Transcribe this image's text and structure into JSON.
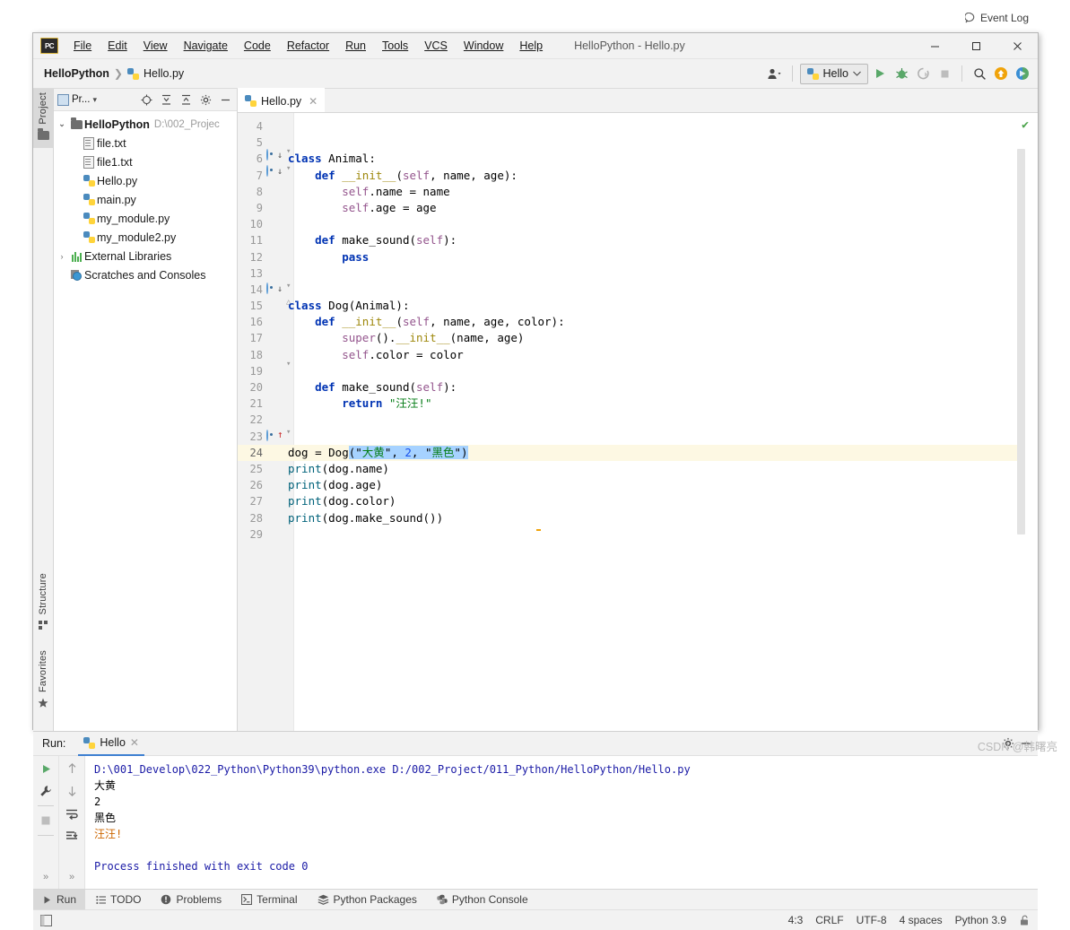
{
  "window": {
    "title": "HelloPython - Hello.py",
    "logo_text": "PC",
    "minimize": "—",
    "maximize": "☐",
    "close": "✕"
  },
  "menu": [
    {
      "label": "File"
    },
    {
      "label": "Edit"
    },
    {
      "label": "View"
    },
    {
      "label": "Navigate"
    },
    {
      "label": "Code"
    },
    {
      "label": "Refactor"
    },
    {
      "label": "Run"
    },
    {
      "label": "Tools"
    },
    {
      "label": "VCS"
    },
    {
      "label": "Window"
    },
    {
      "label": "Help"
    }
  ],
  "breadcrumb": {
    "project": "HelloPython",
    "separator": "❯",
    "file": "Hello.py"
  },
  "toolbar": {
    "run_config": "Hello",
    "chevron": "⌄",
    "user_icon": "user-icon",
    "run_icon": "run-icon",
    "debug_icon": "debug-icon",
    "coverage_icon": "run-with-coverage-icon",
    "stop_icon": "stop-icon",
    "search_icon": "search-everywhere-icon",
    "update_icon": "update-project-icon",
    "profile_icon": "profile-icon"
  },
  "left_strip": [
    {
      "label": "Project",
      "icon": "folder-icon",
      "active": true
    },
    {
      "label": "Structure",
      "icon": "structure-icon",
      "active": false
    },
    {
      "label": "Favorites",
      "icon": "star-icon",
      "active": false
    }
  ],
  "project_panel": {
    "title": "Pr...",
    "title_chevron": "▾",
    "icons": [
      "locate-icon",
      "expand-all-icon",
      "collapse-all-icon",
      "settings-icon",
      "hide-icon"
    ],
    "tree": [
      {
        "label": "HelloPython",
        "path": "D:\\002_Projec",
        "icon": "folder-icon",
        "arrow": "⌄",
        "indent": 0,
        "bold": true
      },
      {
        "label": "file.txt",
        "path": "",
        "icon": "text-file-icon",
        "arrow": "",
        "indent": 1,
        "bold": false
      },
      {
        "label": "file1.txt",
        "path": "",
        "icon": "text-file-icon",
        "arrow": "",
        "indent": 1,
        "bold": false
      },
      {
        "label": "Hello.py",
        "path": "",
        "icon": "python-file-icon",
        "arrow": "",
        "indent": 1,
        "bold": false
      },
      {
        "label": "main.py",
        "path": "",
        "icon": "python-file-icon",
        "arrow": "",
        "indent": 1,
        "bold": false
      },
      {
        "label": "my_module.py",
        "path": "",
        "icon": "python-file-icon",
        "arrow": "",
        "indent": 1,
        "bold": false
      },
      {
        "label": "my_module2.py",
        "path": "",
        "icon": "python-file-icon",
        "arrow": "",
        "indent": 1,
        "bold": false
      },
      {
        "label": "External Libraries",
        "path": "",
        "icon": "libraries-icon",
        "arrow": "›",
        "indent": 0,
        "bold": false
      },
      {
        "label": "Scratches and Consoles",
        "path": "",
        "icon": "scratches-icon",
        "arrow": "",
        "indent": 0,
        "bold": false
      }
    ]
  },
  "editor": {
    "tab": {
      "label": "Hello.py",
      "icon": "python-file-icon",
      "close": "✕"
    },
    "inspection_ok": "✔",
    "first_line": 4,
    "lines": [
      {
        "n": 4,
        "text": ""
      },
      {
        "n": 5,
        "text": ""
      },
      {
        "n": 6,
        "text": "class Animal:"
      },
      {
        "n": 7,
        "text": "    def __init__(self, name, age):"
      },
      {
        "n": 8,
        "text": "        self.name = name"
      },
      {
        "n": 9,
        "text": "        self.age = age"
      },
      {
        "n": 10,
        "text": ""
      },
      {
        "n": 11,
        "text": "    def make_sound(self):"
      },
      {
        "n": 12,
        "text": "        pass"
      },
      {
        "n": 13,
        "text": ""
      },
      {
        "n": 14,
        "text": ""
      },
      {
        "n": 15,
        "text": "class Dog(Animal):"
      },
      {
        "n": 16,
        "text": "    def __init__(self, name, age, color):"
      },
      {
        "n": 17,
        "text": "        super().__init__(name, age)"
      },
      {
        "n": 18,
        "text": "        self.color = color"
      },
      {
        "n": 19,
        "text": ""
      },
      {
        "n": 20,
        "text": "    def make_sound(self):"
      },
      {
        "n": 21,
        "text": "        return \"汪汪!\""
      },
      {
        "n": 22,
        "text": ""
      },
      {
        "n": 23,
        "text": ""
      },
      {
        "n": 24,
        "text": "dog = Dog(\"大黄\", 2, \"黑色\")"
      },
      {
        "n": 25,
        "text": "print(dog.name)"
      },
      {
        "n": 26,
        "text": "print(dog.age)"
      },
      {
        "n": 27,
        "text": "print(dog.color)"
      },
      {
        "n": 28,
        "text": "print(dog.make_sound())"
      },
      {
        "n": 29,
        "text": ""
      }
    ],
    "highlighted_line": 24,
    "selection_text": "(\"大黄\", 2, \"黑色\")",
    "breakpoint_lines": [
      6,
      7,
      11,
      20
    ],
    "bulb_line": 23
  },
  "run_panel": {
    "label": "Run:",
    "tab": "Hello",
    "tab_close": "✕",
    "settings_icon": "gear-icon",
    "hide_icon": "minimize-icon",
    "tools_left": [
      "rerun-icon",
      "settings-wrench-icon",
      "stop-icon",
      "expand-more-icon"
    ],
    "tools_right": [
      "up-icon",
      "down-icon",
      "soft-wrap-icon",
      "scroll-to-end-icon",
      "expand-more-icon"
    ],
    "console": [
      {
        "text": "D:\\001_Develop\\022_Python\\Python39\\python.exe D:/002_Project/011_Python/HelloPython/Hello.py",
        "style": "path"
      },
      {
        "text": "大黄",
        "style": "plain"
      },
      {
        "text": "2",
        "style": "plain"
      },
      {
        "text": "黑色",
        "style": "plain"
      },
      {
        "text": "汪汪!",
        "style": "bang"
      },
      {
        "text": "",
        "style": "plain"
      },
      {
        "text": "Process finished with exit code 0",
        "style": "done"
      }
    ]
  },
  "bottom_tabs": [
    {
      "label": "Run",
      "icon": "run-icon",
      "active": true
    },
    {
      "label": "TODO",
      "icon": "todo-icon",
      "active": false
    },
    {
      "label": "Problems",
      "icon": "problems-icon",
      "active": false
    },
    {
      "label": "Terminal",
      "icon": "terminal-icon",
      "active": false
    },
    {
      "label": "Python Packages",
      "icon": "packages-icon",
      "active": false
    },
    {
      "label": "Python Console",
      "icon": "python-console-icon",
      "active": false
    }
  ],
  "event_log": {
    "label": "Event Log",
    "icon": "balloon-icon"
  },
  "status_bar": {
    "caret": "4:3",
    "line_separator": "CRLF",
    "encoding": "UTF-8",
    "indent": "4 spaces",
    "interpreter": "Python 3.9",
    "lock_icon": "unlocked-icon"
  },
  "watermark": "CSDN @韩曙亮",
  "colors": {
    "accent": "#3d7fd1",
    "keyword": "#0033b3",
    "string": "#067d17",
    "number": "#1750eb",
    "self": "#94558d",
    "function": "#00627a",
    "selection": "#a6d2ff",
    "caret_row": "#fdf8e3"
  }
}
